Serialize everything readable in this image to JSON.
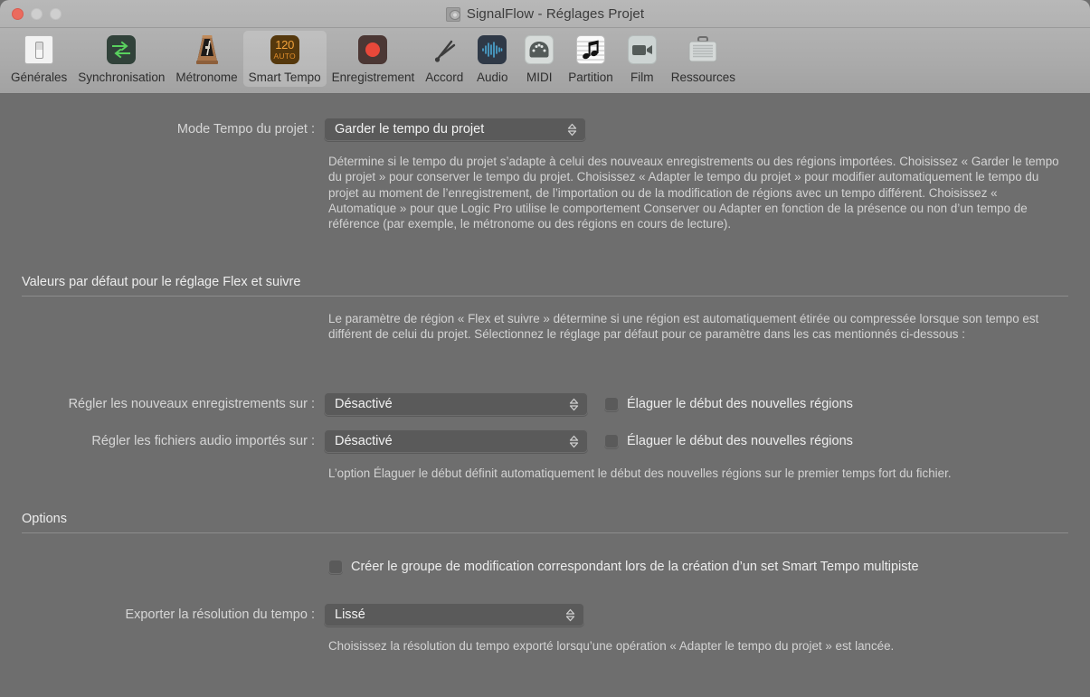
{
  "window": {
    "title": "SignalFlow - Réglages Projet",
    "controls": {
      "close": "close",
      "minimize": "minimize",
      "maximize": "maximize"
    }
  },
  "toolbar": {
    "items": [
      {
        "label": "Générales",
        "icon": "light-switch-icon"
      },
      {
        "label": "Synchronisation",
        "icon": "sync-arrows-icon"
      },
      {
        "label": "Métronome",
        "icon": "metronome-icon"
      },
      {
        "label": "Smart Tempo",
        "icon": "smart-tempo-icon",
        "selected": true,
        "badge_top": "120",
        "badge_bottom": "AUTO"
      },
      {
        "label": "Enregistrement",
        "icon": "record-dot-icon"
      },
      {
        "label": "Accord",
        "icon": "tuning-fork-icon"
      },
      {
        "label": "Audio",
        "icon": "waveform-icon"
      },
      {
        "label": "MIDI",
        "icon": "midi-connector-icon"
      },
      {
        "label": "Partition",
        "icon": "music-note-staff-icon"
      },
      {
        "label": "Film",
        "icon": "video-camera-icon"
      },
      {
        "label": "Ressources",
        "icon": "briefcase-icon"
      }
    ]
  },
  "main": {
    "tempo_mode": {
      "label": "Mode Tempo du projet :",
      "value": "Garder le tempo du projet",
      "description": "Détermine si le tempo du projet s’adapte à celui des nouveaux enregistrements ou des régions importées. Choisissez « Garder le tempo du projet » pour conserver le tempo du projet. Choisissez « Adapter le tempo du projet » pour modifier automatiquement le tempo du projet au moment de l’enregistrement, de l’importation ou de la modification de régions avec un tempo différent. Choisissez « Automatique » pour que Logic Pro utilise le comportement Conserver ou Adapter en fonction de la présence ou non d’un tempo de référence (par exemple, le métronome ou des régions en cours de lecture)."
    },
    "flex_section": {
      "title": "Valeurs par défaut pour le réglage Flex et suivre",
      "description": "Le paramètre de région « Flex et suivre » détermine si une région est automatiquement étirée ou compressée lorsque son tempo est différent de celui du projet. Sélectionnez le réglage par défaut pour ce paramètre dans les cas mentionnés ci-dessous :",
      "new_recordings": {
        "label": "Régler les nouveaux enregistrements sur :",
        "value": "Désactivé",
        "checkbox_label": "Élaguer le début des nouvelles régions",
        "checked": false
      },
      "imported_audio": {
        "label": "Régler les fichiers audio importés sur :",
        "value": "Désactivé",
        "checkbox_label": "Élaguer le début des nouvelles régions",
        "checked": false
      },
      "note": "L’option Élaguer le début définit automatiquement le début des nouvelles régions sur le premier temps fort du fichier."
    },
    "options_section": {
      "title": "Options",
      "edit_group": {
        "checkbox_label": "Créer le groupe de modification correspondant lors de la création d’un set Smart Tempo multipiste",
        "checked": false
      },
      "export_resolution": {
        "label": "Exporter la résolution du tempo :",
        "value": "Lissé",
        "note": "Choisissez la résolution du tempo exporté lorsqu’une opération « Adapter le tempo du projet » est lancée."
      }
    }
  }
}
